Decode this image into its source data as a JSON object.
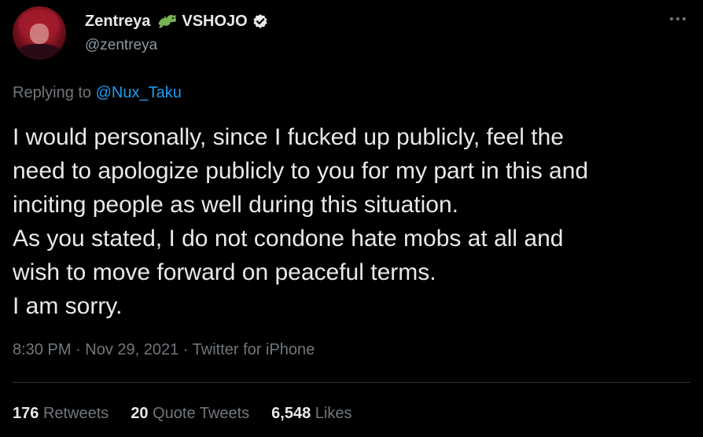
{
  "author": {
    "name": "Zentreya",
    "org": "VSHOJO",
    "handle": "@zentreya"
  },
  "reply": {
    "prefix": "Replying to ",
    "to": "@Nux_Taku"
  },
  "tweet": {
    "lines": [
      "I would personally, since I fucked up publicly, feel the",
      "need to apologize publicly to you for my part in this and",
      "inciting people as well during this situation.",
      "As you stated, I do not condone hate mobs at all and",
      "wish to move forward on peaceful terms.",
      "I am sorry."
    ]
  },
  "meta": {
    "time": "8:30 PM",
    "date": "Nov 29, 2021",
    "source": "Twitter for iPhone",
    "separator": " · "
  },
  "stats": {
    "retweets_count": "176",
    "retweets_label": "Retweets",
    "quotes_count": "20",
    "quotes_label": "Quote Tweets",
    "likes_count": "6,548",
    "likes_label": "Likes"
  },
  "icons": {
    "emoji": "dragon-icon",
    "verified": "verified-badge-icon",
    "more": "more-options-icon"
  },
  "colors": {
    "background": "#000000",
    "text": "#e7e9ea",
    "muted": "#71767b",
    "link": "#1d9bf0",
    "dragon": "#77b255"
  }
}
